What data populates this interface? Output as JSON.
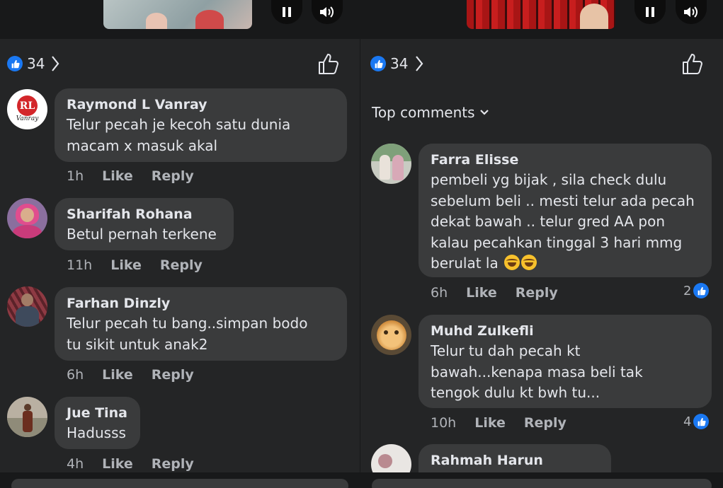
{
  "left": {
    "reaction_count": "34",
    "comments": [
      {
        "name": "Raymond L Vanray",
        "lines": [
          "Telur pecah je kecoh satu dunia",
          "macam x masuk akal"
        ],
        "time": "1h",
        "like": "Like",
        "reply": "Reply",
        "avatar_text": "Vanray"
      },
      {
        "name": "Sharifah Rohana",
        "lines": [
          "Betul pernah terkene"
        ],
        "time": "11h",
        "like": "Like",
        "reply": "Reply"
      },
      {
        "name": "Farhan Dinzly",
        "lines": [
          "Telur pecah tu bang..simpan bodo",
          "tu sikit untuk anak2"
        ],
        "time": "6h",
        "like": "Like",
        "reply": "Reply"
      },
      {
        "name": "Jue Tina",
        "lines": [
          "Hadusss"
        ],
        "time": "4h",
        "like": "Like",
        "reply": "Reply"
      }
    ]
  },
  "right": {
    "reaction_count": "34",
    "top_comments_label": "Top comments",
    "comments": [
      {
        "name": "Farra Elisse",
        "lines": [
          "pembeli yg bijak , sila check dulu",
          "sebelum beli .. mesti telur ada pecah",
          "dekat bawah .. telur gred AA pon",
          "kalau pecahkan tinggal 3 hari mmg",
          "berulat la"
        ],
        "time": "6h",
        "like": "Like",
        "reply": "Reply",
        "reactions": "2"
      },
      {
        "name": "Muhd Zulkefli",
        "lines": [
          "Telur tu dah pecah kt",
          "bawah...kenapa masa beli tak",
          "tengok dulu kt bwh tu..."
        ],
        "time": "10h",
        "like": "Like",
        "reply": "Reply",
        "reactions": "4"
      },
      {
        "name": "Rahmah Harun"
      }
    ]
  },
  "colors": {
    "background": "#242526",
    "bubble": "#3a3b3c",
    "accent": "#1a78f2",
    "secondary_text": "#b0b3b8"
  },
  "icons": [
    "pause-icon",
    "volume-icon",
    "like-reaction-icon",
    "chevron-right-icon",
    "thumbs-up-icon",
    "chevron-down-icon",
    "laughing-emoji-icon"
  ]
}
